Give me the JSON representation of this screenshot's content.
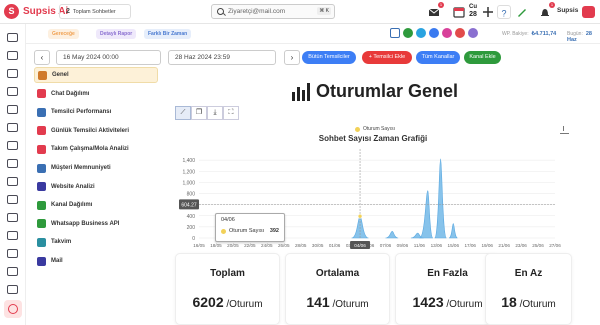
{
  "app": {
    "title": "Supsis Ai",
    "logo_letter": "S"
  },
  "topbar": {
    "chat_count": "2",
    "chat_label": "Toplam Sohbetler",
    "search_placeholder": "Ziyaretçi@mail.com",
    "search_shortcut": "⌘ K",
    "cu_label": "Cu",
    "cu_day": "28",
    "user_name": "Supsis"
  },
  "subbar": {
    "chips": [
      {
        "label": "Gereceğe",
        "color": "#f0a050",
        "bg": "#fdf0e0"
      },
      {
        "label": "Detaylı Rapor",
        "color": "#8a6fd0",
        "bg": "#efe9fb"
      },
      {
        "label": "Farklı Bir Zaman",
        "color": "#4a7ad0",
        "bg": "#e6eefb"
      }
    ],
    "wp_label": "WP. Bakiye:",
    "wp_value": "₺4.711,74",
    "today_label": "Bugün:",
    "today_value": "28 Haz"
  },
  "datebar": {
    "prev": "‹",
    "start_date": "16 May 2024 00:00",
    "end_date": "28 Haz 2024 23:59",
    "next": "›"
  },
  "buttons": [
    {
      "label": "Bütün Temsilciler",
      "color": "#3d7ef5"
    },
    {
      "label": "+ Temsilci Ekle",
      "color": "#e83a3a"
    },
    {
      "label": "Tüm Kanallar",
      "color": "#3d7ef5"
    },
    {
      "label": "Kanal Ekle",
      "color": "#2e9a3c"
    }
  ],
  "sidebar": {
    "items": [
      {
        "label": "Genel",
        "icon": "line-chart-icon",
        "color": "#d07a2a",
        "active": true
      },
      {
        "label": "Chat Dağılımı",
        "icon": "chat-icon",
        "color": "#e23b4e"
      },
      {
        "label": "Temsilci Performansı",
        "icon": "person-icon",
        "color": "#3a6fb3"
      },
      {
        "label": "Günlük Temsilci Aktiviteleri",
        "icon": "wifi-icon",
        "color": "#e23b4e"
      },
      {
        "label": "Takım Çalışma/Mola Analizi",
        "icon": "timer-icon",
        "color": "#e23b4e"
      },
      {
        "label": "Müşteri Memnuniyeti",
        "icon": "smile-icon",
        "color": "#3a6fb3"
      },
      {
        "label": "Website Analizi",
        "icon": "globe-icon",
        "color": "#3a3aa0"
      },
      {
        "label": "Kanal Dağılımı",
        "icon": "share-icon",
        "color": "#2e9a3c"
      },
      {
        "label": "Whatsapp Business API",
        "icon": "whatsapp-icon",
        "color": "#2e9a3c"
      },
      {
        "label": "Takvim",
        "icon": "calendar-icon",
        "color": "#2a8fa0"
      },
      {
        "label": "Mail",
        "icon": "mail-icon",
        "color": "#3a3aa0"
      }
    ]
  },
  "page": {
    "title": "Oturumlar Genel"
  },
  "chart_data": {
    "type": "area",
    "title": "Sohbet Sayısı Zaman Grafiği",
    "legend": [
      "Oturum Sayısı"
    ],
    "ylim": [
      0,
      1600
    ],
    "yticks": [
      "0",
      "200",
      "400",
      "600",
      "800",
      "1,000",
      "1,200",
      "1,400"
    ],
    "x": [
      "16/05",
      "18/05",
      "20/05",
      "22/05",
      "24/05",
      "26/05",
      "28/05",
      "30/05",
      "01/06",
      "03/06",
      "05/06",
      "07/06",
      "09/06",
      "11/06",
      "13/06",
      "15/06",
      "17/06",
      "19/06",
      "21/06",
      "23/06",
      "25/06",
      "27/06"
    ],
    "series": [
      {
        "name": "Oturum Sayısı",
        "color": "#72b8e8",
        "points": [
          [
            "22/05",
            0
          ],
          [
            "22.5/05",
            280
          ],
          [
            "23/05",
            0
          ],
          [
            "03/06",
            0
          ],
          [
            "04/06",
            392
          ],
          [
            "05/06",
            0
          ],
          [
            "07/06",
            0
          ],
          [
            "07.8/06",
            120
          ],
          [
            "08.5/06",
            0
          ],
          [
            "10/06",
            0
          ],
          [
            "10.8/06",
            90
          ],
          [
            "11.5/06",
            0
          ],
          [
            "11/06",
            0
          ],
          [
            "12/06",
            850
          ],
          [
            "12.6/06",
            0
          ],
          [
            "12.8/06",
            0
          ],
          [
            "13.5/06",
            1423
          ],
          [
            "14.2/06",
            0
          ],
          [
            "14.5/06",
            0
          ],
          [
            "15/06",
            260
          ],
          [
            "15.5/06",
            0
          ]
        ]
      }
    ],
    "crosshair_value": "604.27",
    "crosshair_x": "04/06",
    "tooltip": {
      "date": "04/06",
      "label": "Oturum Sayısı",
      "value": "392"
    }
  },
  "stats": [
    {
      "title": "Toplam",
      "value": "6202",
      "unit": " /Oturum"
    },
    {
      "title": "Ortalama",
      "value": "141",
      "unit": " /Oturum"
    },
    {
      "title": "En Fazla",
      "value": "1423",
      "unit": " /Oturum"
    },
    {
      "title": "En Az",
      "value": "18",
      "unit": " /Oturum"
    }
  ]
}
